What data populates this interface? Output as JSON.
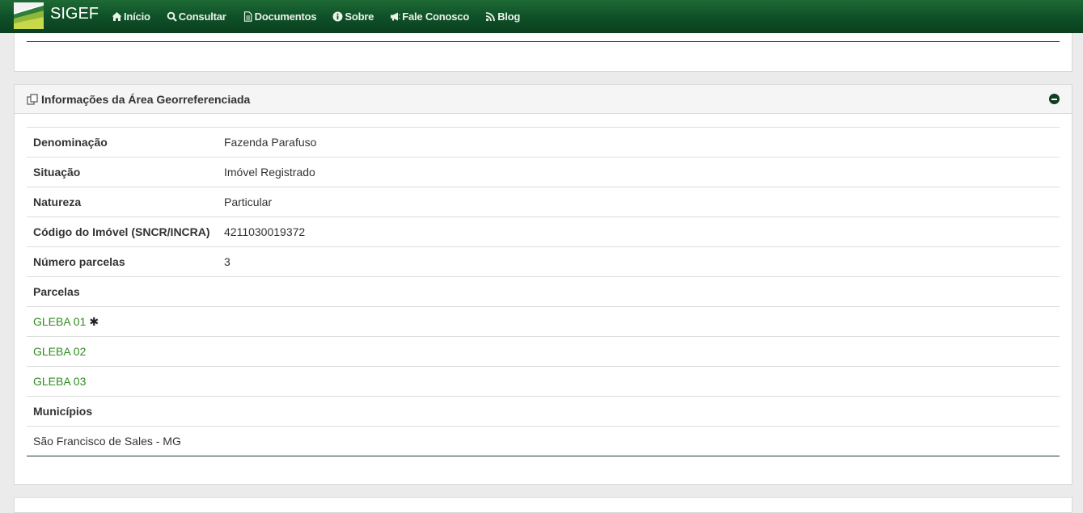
{
  "brand": {
    "name": "SIGEF",
    "logo_icon": "sigef-logo-icon"
  },
  "nav": {
    "items": [
      {
        "label": "Início",
        "icon": "home-icon"
      },
      {
        "label": "Consultar",
        "icon": "search-icon"
      },
      {
        "label": "Documentos",
        "icon": "document-icon"
      },
      {
        "label": "Sobre",
        "icon": "info-icon"
      },
      {
        "label": "Fale Conosco",
        "icon": "megaphone-icon"
      },
      {
        "label": "Blog",
        "icon": "rss-icon"
      }
    ]
  },
  "panel": {
    "title": "Informações da Área Georreferenciada",
    "title_icon": "copy-icon",
    "rows": {
      "denominacao": {
        "label": "Denominação",
        "value": "Fazenda Parafuso"
      },
      "situacao": {
        "label": "Situação",
        "value": "Imóvel Registrado"
      },
      "natureza": {
        "label": "Natureza",
        "value": "Particular"
      },
      "codigo": {
        "label": "Código do Imóvel (SNCR/INCRA)",
        "value": "4211030019372"
      },
      "numero_parcelas": {
        "label": "Número parcelas",
        "value": "3"
      }
    },
    "parcelas_label": "Parcelas",
    "parcelas": [
      {
        "name": "GLEBA 01",
        "marker": "✱"
      },
      {
        "name": "GLEBA 02"
      },
      {
        "name": "GLEBA 03"
      }
    ],
    "municipios_label": "Municípios",
    "municipios": [
      "São Francisco de Sales - MG"
    ]
  },
  "colors": {
    "navbar": "#0f5128",
    "link": "#2e8b1f",
    "rule": "#1f3d2b"
  }
}
